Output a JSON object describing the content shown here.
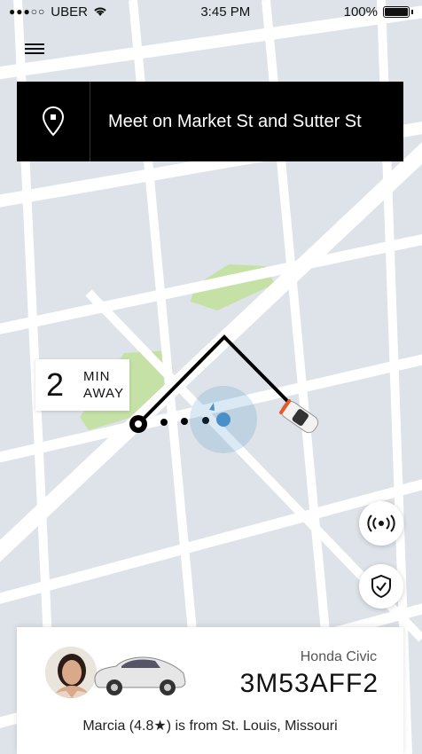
{
  "status_bar": {
    "carrier": "UBER",
    "time": "3:45 PM",
    "battery": "100%"
  },
  "destination": {
    "text": "Meet on Market St and Sutter St"
  },
  "eta": {
    "minutes": "2",
    "unit_line1": "MIN",
    "unit_line2": "AWAY"
  },
  "driver_card": {
    "car_model": "Honda Civic",
    "plate": "3M53AFF2",
    "driver_name": "Marcia",
    "rating": "(4.8★)",
    "origin_text": "is from St. Louis, Missouri"
  },
  "colors": {
    "map_bg": "#dde3e8",
    "road": "#ffffff",
    "park": "#c5e1a5",
    "pickup_blue": "#4a90c8",
    "dark": "#000000"
  },
  "icons": {
    "menu": "hamburger-menu-icon",
    "pin": "location-pin-icon",
    "beacon": "beacon-icon",
    "safety": "shield-check-icon"
  }
}
